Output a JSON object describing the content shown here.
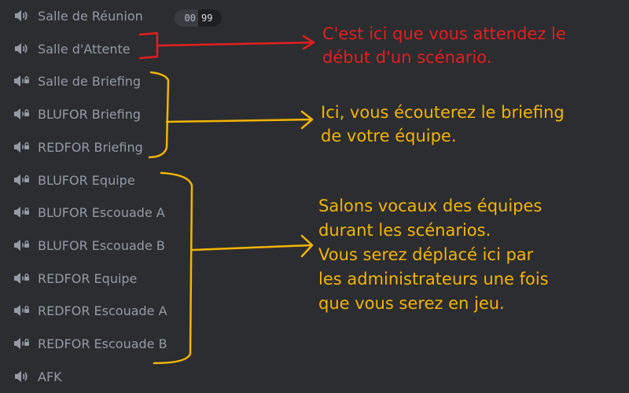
{
  "channels": [
    {
      "label": "Salle de Réunion",
      "icon": "speaker-icon"
    },
    {
      "label": "Salle d'Attente",
      "icon": "speaker-icon"
    },
    {
      "label": "Salle de Briefing",
      "icon": "locked-speaker-icon"
    },
    {
      "label": "BLUFOR Briefing",
      "icon": "locked-speaker-icon"
    },
    {
      "label": "REDFOR Briefing",
      "icon": "locked-speaker-icon"
    },
    {
      "label": "BLUFOR Equipe",
      "icon": "locked-speaker-icon"
    },
    {
      "label": "BLUFOR Escouade A",
      "icon": "locked-speaker-icon"
    },
    {
      "label": "BLUFOR Escouade B",
      "icon": "locked-speaker-icon"
    },
    {
      "label": "REDFOR Equipe",
      "icon": "locked-speaker-icon"
    },
    {
      "label": "REDFOR Escouade A",
      "icon": "locked-speaker-icon"
    },
    {
      "label": "REDFOR Escouade B",
      "icon": "locked-speaker-icon"
    },
    {
      "label": "AFK",
      "icon": "speaker-icon"
    }
  ],
  "user_count_badge": {
    "current": "00",
    "limit": "99"
  },
  "annotations": {
    "waiting_room": [
      "C'est ici que vous attendez le",
      "début d'un scénario."
    ],
    "briefing": [
      "Ici, vous écouterez le briefing",
      "de votre équipe."
    ],
    "team_channels": [
      "Salons vocaux des équipes",
      "durant les scénarios.",
      "Vous serez déplacé ici par",
      "les administrateurs une fois",
      "que vous serez en jeu."
    ]
  },
  "colors": {
    "background": "#2b2d31",
    "channel_text": "#949ba4",
    "annotation_red": "#e41e1e",
    "annotation_yellow": "#f4b400"
  }
}
